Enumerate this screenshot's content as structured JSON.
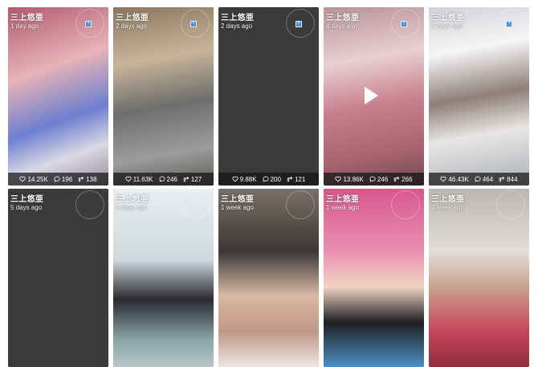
{
  "cards": [
    {
      "author": "三上悠亜",
      "time": "1 day ago",
      "likes": "14.25K",
      "comments": "196",
      "shares": "138",
      "badge": "?",
      "play": false,
      "stats": true,
      "bg": "linear-gradient(160deg,#b05a6e 0%,#e7b3b7 35%,#6d7fcf 62%,#d9d9e5 80%,#9a8a9c 100%)"
    },
    {
      "author": "三上悠亜",
      "time": "2 days ago",
      "likes": "11.63K",
      "comments": "246",
      "shares": "127",
      "badge": "?",
      "play": false,
      "stats": true,
      "bg": "linear-gradient(170deg,#8b7660 0%,#c8b49a 30%,#6e6f6c 55%,#9b9d9a 80%,#5c5a55 100%)"
    },
    {
      "author": "三上悠亜",
      "time": "2 days ago",
      "likes": "9.88K",
      "comments": "200",
      "shares": "121",
      "badge": "?",
      "play": false,
      "stats": true,
      "bg": "#3b3b3b"
    },
    {
      "author": "三上悠亜",
      "time": "4 days ago",
      "likes": "13.86K",
      "comments": "246",
      "shares": "266",
      "badge": "?",
      "play": true,
      "stats": true,
      "bg": "linear-gradient(170deg,#b89298 0%,#e8cfd3 30%,#c77f8d 55%,#a86470 80%,#6e4a52 100%)"
    },
    {
      "author": "三上悠亜",
      "time": "5 days ago",
      "likes": "46.43K",
      "comments": "464",
      "shares": "844",
      "badge": "?",
      "play": false,
      "stats": true,
      "bg": "linear-gradient(170deg,#cfd3d8 0%,#f5f5f5 25%,#8f7f7a 50%,#e8e6e4 70%,#a9b0b6 100%)"
    },
    {
      "author": "三上悠亜",
      "time": "5 days ago",
      "likes": "",
      "comments": "",
      "shares": "",
      "badge": "",
      "play": false,
      "stats": false,
      "bg": "#3b3b3b"
    },
    {
      "author": "三上悠亜",
      "time": "6 days ago",
      "likes": "",
      "comments": "",
      "shares": "",
      "badge": "",
      "play": false,
      "stats": false,
      "bg": "linear-gradient(180deg,#e9eef0 0%,#cfd8dc 40%,#2a2a30 62%,#8aa6a8 85%,#b8c8c8 100%)"
    },
    {
      "author": "三上悠亜",
      "time": "1 week ago",
      "likes": "",
      "comments": "",
      "shares": "",
      "badge": "",
      "play": false,
      "stats": false,
      "bg": "linear-gradient(180deg,#7a6f68 0%,#3a3836 35%,#d9b8a6 60%,#c09887 80%,#ece6e1 100%)"
    },
    {
      "author": "三上悠亜",
      "time": "1 week ago",
      "likes": "",
      "comments": "",
      "shares": "",
      "badge": "",
      "play": false,
      "stats": false,
      "bg": "linear-gradient(180deg,#d7588e 0%,#e98fb0 35%,#f1d3c3 55%,#1f1f24 75%,#4b8fc4 100%)"
    },
    {
      "author": "三上悠亜",
      "time": "1 week ago",
      "likes": "",
      "comments": "",
      "shares": "",
      "badge": "",
      "play": false,
      "stats": false,
      "bg": "linear-gradient(180deg,#b9b5b1 0%,#e2ded9 35%,#caa28f 55%,#c6455a 80%,#8e2e3c 100%)"
    }
  ],
  "icons": {
    "likes": "heart-icon",
    "comments": "comment-icon",
    "shares": "share-icon",
    "play": "play-icon"
  }
}
